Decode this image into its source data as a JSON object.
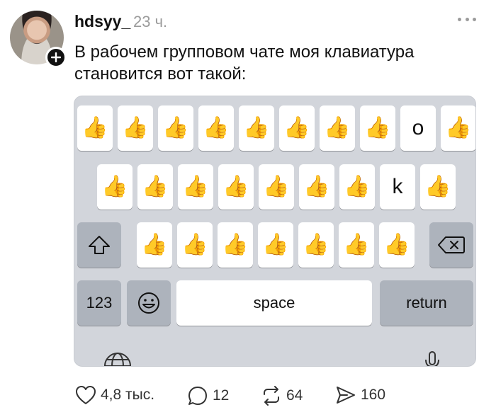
{
  "post": {
    "username": "hdsyy_",
    "time": "23 ч.",
    "text": "В рабочем групповом чате моя клавиатура становится вот такой:"
  },
  "keyboard": {
    "thumb_glyph": "👍",
    "row1": [
      "👍",
      "👍",
      "👍",
      "👍",
      "👍",
      "👍",
      "👍",
      "👍",
      "o",
      "👍"
    ],
    "row2": [
      "👍",
      "👍",
      "👍",
      "👍",
      "👍",
      "👍",
      "👍",
      "k",
      "👍"
    ],
    "row3": [
      "👍",
      "👍",
      "👍",
      "👍",
      "👍",
      "👍",
      "👍"
    ],
    "shift_icon": "shift-icon",
    "backspace_icon": "backspace-icon",
    "numbers_label": "123",
    "emoji_icon": "emoji-icon",
    "space_label": "space",
    "return_label": "return",
    "globe_icon": "globe-icon",
    "mic_icon": "microphone-icon"
  },
  "actions": {
    "likes": "4,8 тыс.",
    "replies": "12",
    "reposts": "64",
    "shares": "160"
  },
  "colors": {
    "keyboard_bg": "#d2d5db",
    "key_light": "#ffffff",
    "key_dark": "#adb3bc",
    "muted_text": "#9b9b9b"
  }
}
